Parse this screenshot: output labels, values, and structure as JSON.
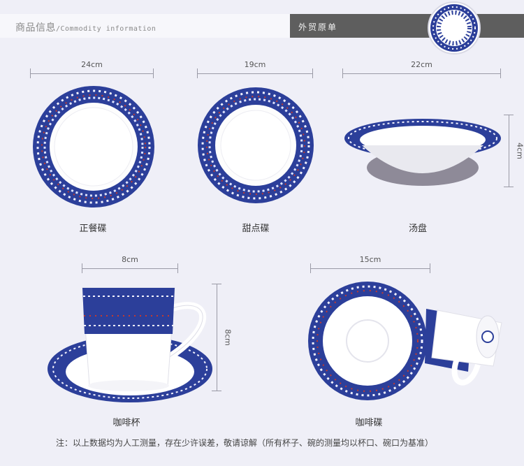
{
  "header": {
    "title_cn": "商品信息",
    "title_en": "/Commodity information",
    "right_label": "外贸原单"
  },
  "items": [
    {
      "name": "正餐碟",
      "dimension": "24cm"
    },
    {
      "name": "甜点碟",
      "dimension": "19cm"
    },
    {
      "name": "汤盘",
      "dimension": "22cm",
      "height": "4cm"
    },
    {
      "name": "咖啡杯",
      "dimension": "8cm",
      "height": "8cm"
    },
    {
      "name": "咖啡碟",
      "dimension": "15cm"
    }
  ],
  "note": "注：以上数据均为人工测量，存在少许误差，敬请谅解（所有杯子、碗的测量均以杯口、碗口为基准）",
  "colors": {
    "pattern_blue": "#2c3f9a",
    "pattern_red": "#c43a2e",
    "porcelain": "#ffffff",
    "header_dark": "#5e5e5e"
  }
}
